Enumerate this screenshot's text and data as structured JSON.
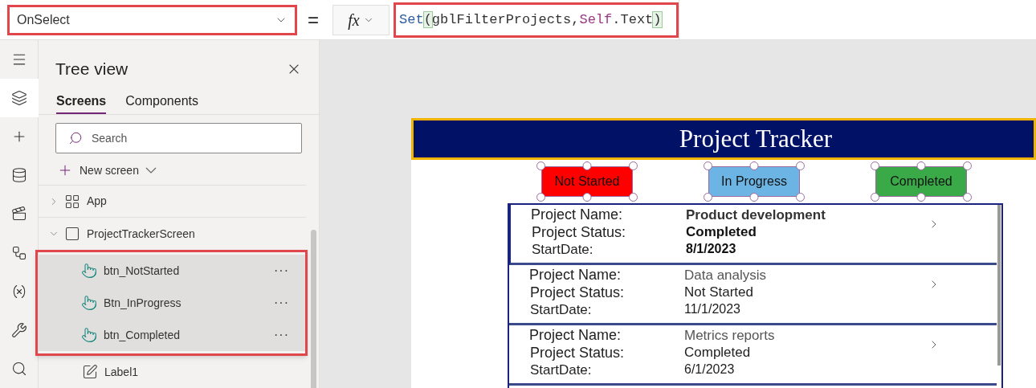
{
  "formula_bar": {
    "property": "OnSelect",
    "equals": "=",
    "fx": "fx",
    "tokens": [
      {
        "text": "Set",
        "kind": "function"
      },
      {
        "text": "(",
        "kind": "paren"
      },
      {
        "text": "gblFilterProjects,",
        "kind": "plain"
      },
      {
        "text": "Self",
        "kind": "keyword"
      },
      {
        "text": ".Text",
        "kind": "plain"
      },
      {
        "text": ")",
        "kind": "paren"
      }
    ]
  },
  "rail": {
    "items": [
      {
        "kind": "menu",
        "selected": false
      },
      {
        "kind": "layers",
        "selected": true
      },
      {
        "kind": "insert",
        "selected": false
      },
      {
        "kind": "data",
        "selected": false
      },
      {
        "kind": "media",
        "selected": false
      },
      {
        "kind": "flow",
        "selected": false
      },
      {
        "kind": "variables",
        "selected": false
      },
      {
        "kind": "tools",
        "selected": false
      },
      {
        "kind": "search",
        "selected": false
      }
    ]
  },
  "tree_view": {
    "title": "Tree view",
    "tabs": [
      {
        "label": "Screens",
        "selected": true
      },
      {
        "label": "Components",
        "selected": false
      }
    ],
    "search": {
      "placeholder": "Search"
    },
    "new_screen": "New screen",
    "items": [
      {
        "label": "App",
        "kind": "app",
        "expanded": false
      },
      {
        "label": "ProjectTrackerScreen",
        "kind": "screen",
        "expanded": true,
        "children": [
          {
            "label": "btn_NotStarted",
            "kind": "button",
            "selected": true,
            "more": "···"
          },
          {
            "label": "Btn_InProgress",
            "kind": "button",
            "selected": true,
            "more": "···"
          },
          {
            "label": "btn_Completed",
            "kind": "button",
            "selected": true,
            "more": "···"
          },
          {
            "label": "Label1",
            "kind": "label",
            "selected": false
          }
        ]
      }
    ]
  },
  "app_screen": {
    "title": "Project Tracker",
    "buttons": [
      {
        "label": "Not Started",
        "color": "#ff0000",
        "selected": true
      },
      {
        "label": "In Progress",
        "color": "#6cb4e4",
        "selected": true
      },
      {
        "label": "Completed",
        "color": "#3aaa48",
        "selected": true
      }
    ],
    "gallery": [
      {
        "name_label": "Project Name:",
        "name": "Product development",
        "status_label": "Project Status:",
        "status": "Completed",
        "date_label": "StartDate:",
        "date": "8/1/2023",
        "selected": true
      },
      {
        "name_label": "Project Name:",
        "name": "Data analysis",
        "status_label": "Project Status:",
        "status": "Not Started",
        "date_label": "StartDate:",
        "date": "11/1/2023",
        "selected": false
      },
      {
        "name_label": "Project Name:",
        "name": "Metrics reports",
        "status_label": "Project Status:",
        "status": "Completed",
        "date_label": "StartDate:",
        "date": "6/1/2023",
        "selected": false
      }
    ]
  }
}
